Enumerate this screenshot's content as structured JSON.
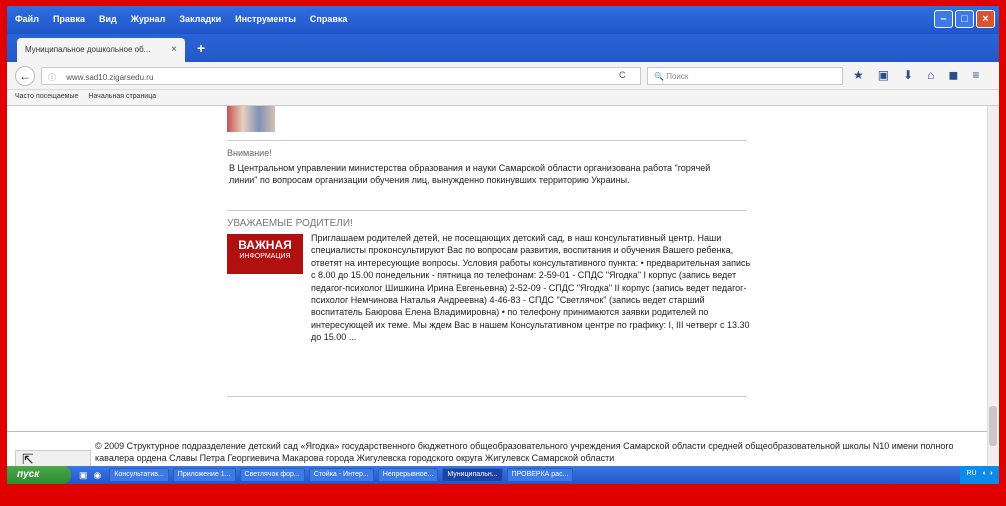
{
  "menubar": {
    "items": [
      "Файл",
      "Правка",
      "Вид",
      "Журнал",
      "Закладки",
      "Инструменты",
      "Справка"
    ]
  },
  "tab": {
    "title": "Муниципальное дошкольное об...",
    "close": "×",
    "new": "+"
  },
  "address": {
    "url": "www.sad10.zigarsedu.ru",
    "info": "ⓘ",
    "reload": "C",
    "search_placeholder": "Поиск"
  },
  "bookmarks": [
    "Часто посещаемые",
    "Начальная страница"
  ],
  "content": {
    "attention_title": "Внимание!",
    "attention_text": "В Центральном управлении министерства образования и науки Самарской области организована работа \"горячей линии\" по вопросам организации обучения лиц, вынужденно покинувших территорию Украины.",
    "parents_title": "УВАЖАЕМЫЕ РОДИТЕЛИ!",
    "badge_main": "ВАЖНАЯ",
    "badge_sub": "ИНФОРМАЦИЯ",
    "parents_text": "Приглашаем родителей детей, не посещающих детский сад, в наш консультативный центр. Наши специалисты проконсультируют Вас по вопросам развития, воспитания и обучения Вашего ребенка, ответят на интересующие вопросы. Условия работы консультативного пункта: • предварительная запись с 8.00 до 15.00 понедельник - пятница по телефонам: 2-59-01 - СПДС \"Ягодка\" I корпус (запись ведет педагог-психолог Шишкина Ирина Евгеньевна) 2-52-09 - СПДС \"Ягодка\" II корпус (запись ведет педагог-психолог Немчинова Наталья Андреевна) 4-46-83 - СПДС \"Светлячок\" (запись ведет старший воспитатель Баюрова Елена Владимировна) • по телефону принимаются заявки родителей по интересующей их теме. Мы ждем Вас в нашем Консультативном центре по графику: I, III четверг с 13.30 до 15.00 ..."
  },
  "footer": {
    "copyright": "© 2009 Структурное подразделение детский сад «Ягодка» государственного бюджетного общеобразовательного учреждения Самарской области средней общеобразовательной школы N10 имени полного кавалера ордена Славы Петра Георгиевича Макарова города Жигулевска городского округа Жигулевск Самарской области",
    "arrow": "⇱"
  },
  "taskbar": {
    "start": "пуск",
    "tasks": [
      "Консультатив...",
      "Приложение 1...",
      "Светлячок фор...",
      "Стойка - Интер...",
      "Непрерывное...",
      "Муниципальн...",
      "ПРОВЕРКА рас..."
    ],
    "tray": "RU"
  }
}
